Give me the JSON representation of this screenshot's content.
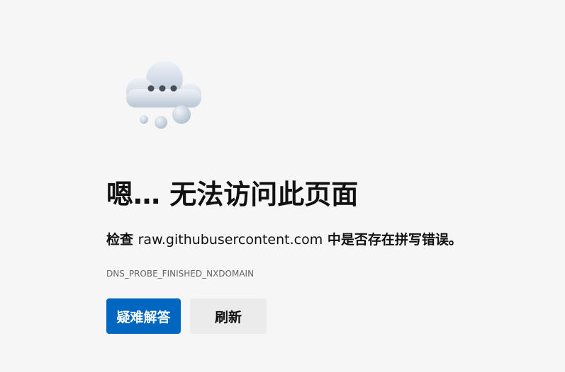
{
  "error": {
    "title": "嗯… 无法访问此页面",
    "subtitle_prefix": "检查 ",
    "host": "raw.githubusercontent.com",
    "subtitle_suffix": " 中是否存在拼写错误。",
    "code": "DNS_PROBE_FINISHED_NXDOMAIN"
  },
  "buttons": {
    "troubleshoot_label": "疑难解答",
    "refresh_label": "刷新"
  },
  "icons": {
    "illustration": "cloud-with-dots-icon"
  },
  "colors": {
    "background": "#f6f6f6",
    "accent": "#0067c0",
    "secondary_button": "#ebebeb"
  }
}
